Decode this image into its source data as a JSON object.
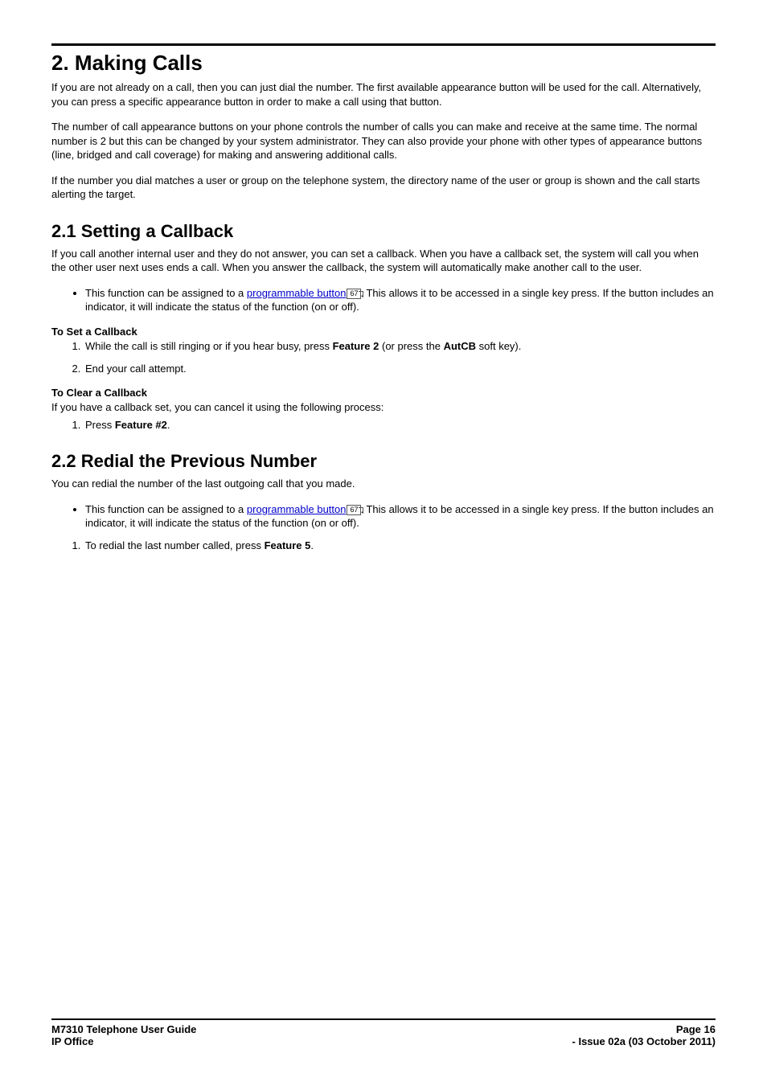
{
  "title": "2. Making Calls",
  "intro": [
    "If you are not already on a call, then you can just dial the number. The first available appearance button will be used for the call. Alternatively, you can press a specific appearance button in order to make a call using that button.",
    "The number of call appearance buttons on your phone controls the number of calls you can make and receive at the same time. The normal number is 2 but this can be changed by your system administrator. They can also provide your phone with other types of appearance buttons (line, bridged and call coverage) for making and answering additional calls.",
    "If the number you dial matches a user or group on the telephone system, the directory name of the user or group is shown and the call starts alerting the target."
  ],
  "s21": {
    "heading": "2.1 Setting a Callback",
    "intro": "If you call another internal user and they do not answer, you can set a callback. When you have a callback set, the system will call you when the other user next uses ends a call. When you answer the callback, the system will automatically make another call to the user.",
    "bullet_pre": "This function can be assigned to a ",
    "bullet_link": "programmable button",
    "bullet_ref": "67",
    "bullet_post": ". This allows it to be accessed in a single key press. If the button includes an indicator, it will indicate the status of the function (on or off).",
    "toset_heading": "To Set a Callback",
    "toset_step1_pre": "While the call is still ringing or if you hear busy, press ",
    "toset_step1_b1": "Feature 2",
    "toset_step1_mid": " (or press the ",
    "toset_step1_b2": "AutCB",
    "toset_step1_post": " soft key).",
    "toset_step2": "End your call attempt.",
    "toclear_heading": "To Clear a Callback",
    "toclear_intro": "If you have a callback set, you can cancel it using the following process:",
    "toclear_step1_pre": "Press ",
    "toclear_step1_b": "Feature #2",
    "toclear_step1_post": "."
  },
  "s22": {
    "heading": "2.2 Redial the Previous Number",
    "intro": "You can redial the number of the last outgoing call that you made.",
    "bullet_pre": "This function can be assigned to a ",
    "bullet_link": "programmable button",
    "bullet_ref": "67",
    "bullet_post": ". This allows it to be accessed in a single key press. If the button includes an indicator, it will indicate the status of the function (on or off).",
    "step1_pre": "To redial the last number called, press ",
    "step1_b": "Feature 5",
    "step1_post": "."
  },
  "footer": {
    "left1": "M7310 Telephone User Guide",
    "right1": "Page 16",
    "left2": "IP Office",
    "right2": "- Issue 02a (03 October 2011)"
  }
}
